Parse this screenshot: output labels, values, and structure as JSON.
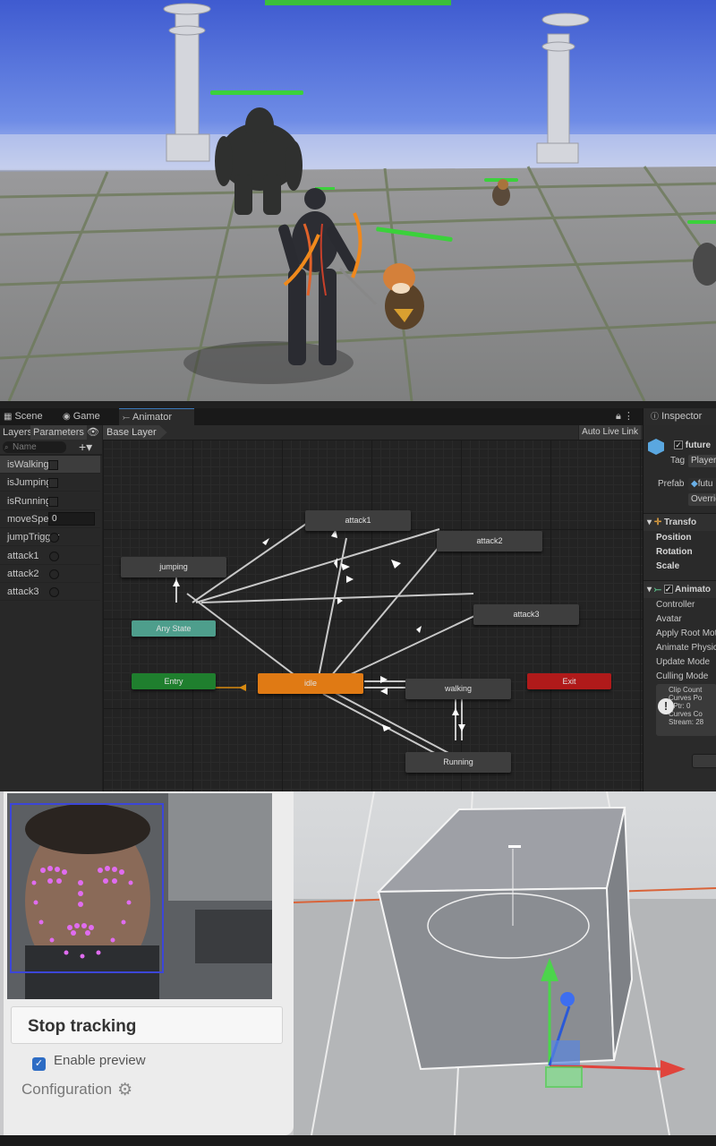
{
  "editor": {
    "tabs": [
      {
        "label": "Scene",
        "icon": "scene-icon"
      },
      {
        "label": "Game",
        "icon": "gamepad-icon"
      },
      {
        "label": "Animator",
        "icon": "animator-icon"
      }
    ],
    "left_panel": {
      "tabs": [
        "Layers",
        "Parameters"
      ],
      "search_placeholder": "Name",
      "add_label": "+▾",
      "parameters": [
        {
          "name": "isWalking",
          "type": "bool"
        },
        {
          "name": "isJumping",
          "type": "bool"
        },
        {
          "name": "isRunning",
          "type": "bool"
        },
        {
          "name": "moveSpeed",
          "type": "float",
          "value": "0"
        },
        {
          "name": "jumpTrigger",
          "type": "trigger"
        },
        {
          "name": "attack1",
          "type": "trigger"
        },
        {
          "name": "attack2",
          "type": "trigger"
        },
        {
          "name": "attack3",
          "type": "trigger"
        }
      ]
    },
    "breadcrumb": "Base Layer",
    "auto_live_link": "Auto Live Link",
    "states": {
      "attack1": "attack1",
      "attack2": "attack2",
      "attack3": "attack3",
      "jumping": "jumping",
      "any_state": "Any State",
      "entry": "Entry",
      "idle": "idle",
      "walking": "walking",
      "exit": "Exit",
      "running": "Running"
    },
    "colors": {
      "state_default": "#3e3e3e",
      "any_state": "#4e9e8c",
      "entry": "#1f7f2e",
      "default_state": "#e07a14",
      "exit": "#b01a1a"
    },
    "inspector": {
      "title": "Inspector",
      "object_name": "future",
      "tag_label": "Tag",
      "tag_value": "Player",
      "prefab_label": "Prefab",
      "prefab_value": "futu",
      "overrides_label": "Overric",
      "transform_title": "Transfo",
      "position": "Position",
      "rotation": "Rotation",
      "scale": "Scale",
      "animator_title": "Animato",
      "fields": [
        "Controller",
        "Avatar",
        "Apply Root Mot",
        "Animate Physic",
        "Update Mode",
        "Culling Mode"
      ],
      "info_lines": [
        "Clip Count",
        "Curves Po",
        "PPtr: 0",
        "Curves Co",
        "Stream: 28"
      ]
    }
  },
  "tracking": {
    "stop_label": "Stop tracking",
    "enable_preview_label": "Enable preview",
    "enable_preview_checked": true,
    "configuration_label": "Configuration",
    "gear_icon": "gear-icon"
  }
}
